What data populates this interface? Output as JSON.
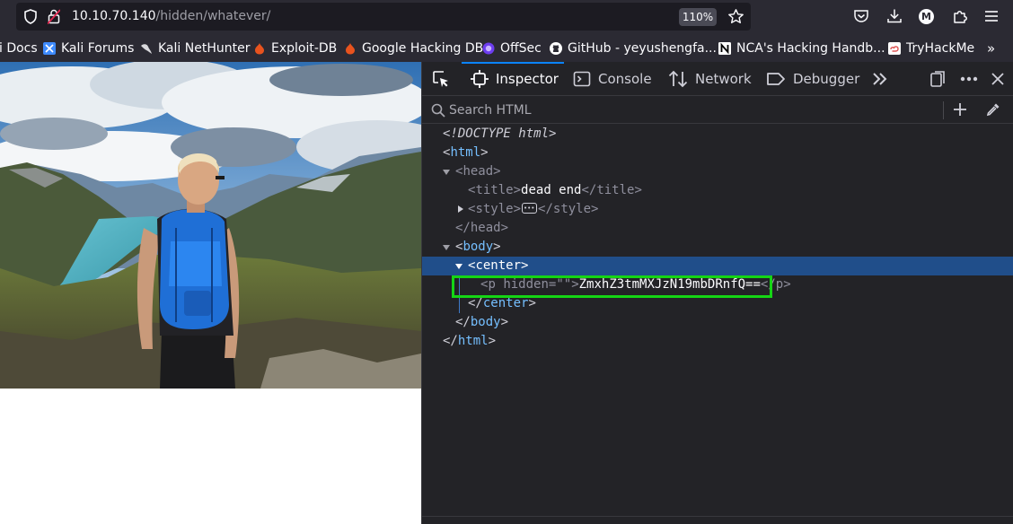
{
  "browser": {
    "url_host": "10.10.70.140",
    "url_path": "/hidden/whatever/",
    "zoom": "110%",
    "account_initial": "M"
  },
  "bookmarks": [
    {
      "label": "i Docs",
      "icon": "docs-icon",
      "color": "#ffffff"
    },
    {
      "label": "Kali Forums",
      "icon": "kali-forums-icon",
      "color": "#3e8bff"
    },
    {
      "label": "Kali NetHunter",
      "icon": "kali-dragon-icon",
      "color": "#cccccc"
    },
    {
      "label": "Exploit-DB",
      "icon": "exploit-db-icon",
      "color": "#e8531e"
    },
    {
      "label": "Google Hacking DB",
      "icon": "ghdb-icon",
      "color": "#e8531e"
    },
    {
      "label": "OffSec",
      "icon": "offsec-icon",
      "color": "#8a5cf6"
    },
    {
      "label": "GitHub - yeyushengfa...",
      "icon": "github-icon",
      "color": "#ffffff"
    },
    {
      "label": "NCA's Hacking Handb...",
      "icon": "nca-icon",
      "color": "#ffffff"
    },
    {
      "label": "TryHackMe",
      "icon": "tryhackme-icon",
      "color": "#e05858"
    }
  ],
  "devtools": {
    "tabs": [
      {
        "label": "Inspector",
        "icon": "inspector-icon",
        "active": true
      },
      {
        "label": "Console",
        "icon": "console-icon",
        "active": false
      },
      {
        "label": "Network",
        "icon": "network-icon",
        "active": false
      },
      {
        "label": "Debugger",
        "icon": "debugger-icon",
        "active": false
      }
    ],
    "search_placeholder": "Search HTML",
    "markup": {
      "doctype": "<!DOCTYPE html>",
      "html_tag": "html",
      "head_tag": "head",
      "title_tag": "title",
      "title_text": "dead end",
      "style_tag": "style",
      "body_tag": "body",
      "center_tag": "center",
      "p_tag": "p",
      "p_attr_name": "hidden",
      "p_attr_value": "\"\"",
      "p_text": "ZmxhZ3tmMXJzN19mbDRnfQ=="
    },
    "highlight_color": "#15d515",
    "selection_color": "#204e8a",
    "accent_color": "#0a84ff"
  }
}
